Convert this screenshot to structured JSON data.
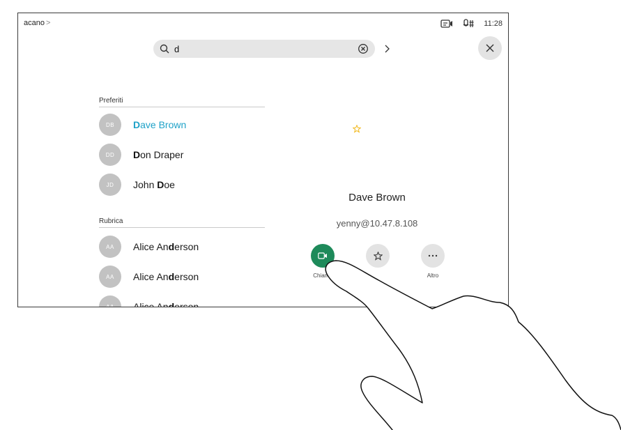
{
  "status": {
    "app_name": "acano",
    "time": "11:28"
  },
  "search": {
    "query": "d"
  },
  "sections": {
    "favorites": "Preferiti",
    "directory": "Rubrica"
  },
  "favorites": [
    {
      "initials": "DB",
      "prefix": "D",
      "rest": "ave Brown",
      "active": true
    },
    {
      "initials": "DD",
      "prefix": "D",
      "rest": "on Draper",
      "active": false
    },
    {
      "initials": "JD",
      "pre": "John ",
      "prefix": "D",
      "rest": "oe",
      "active": false
    }
  ],
  "directory": [
    {
      "initials": "AA",
      "pre": "Alice An",
      "prefix": "d",
      "rest": "erson"
    },
    {
      "initials": "AA",
      "pre": "Alice An",
      "prefix": "d",
      "rest": "erson"
    },
    {
      "initials": "AA",
      "pre": "Alice An",
      "prefix": "d",
      "rest": "erson"
    }
  ],
  "detail": {
    "name": "Dave Brown",
    "address": "yenny@10.47.8.108",
    "actions": {
      "call": "Chiama",
      "favorite": "",
      "more": "Altro"
    }
  },
  "colors": {
    "accent": "#1fa2c8",
    "call_green": "#1e8a5a",
    "star": "#f2b81a"
  }
}
